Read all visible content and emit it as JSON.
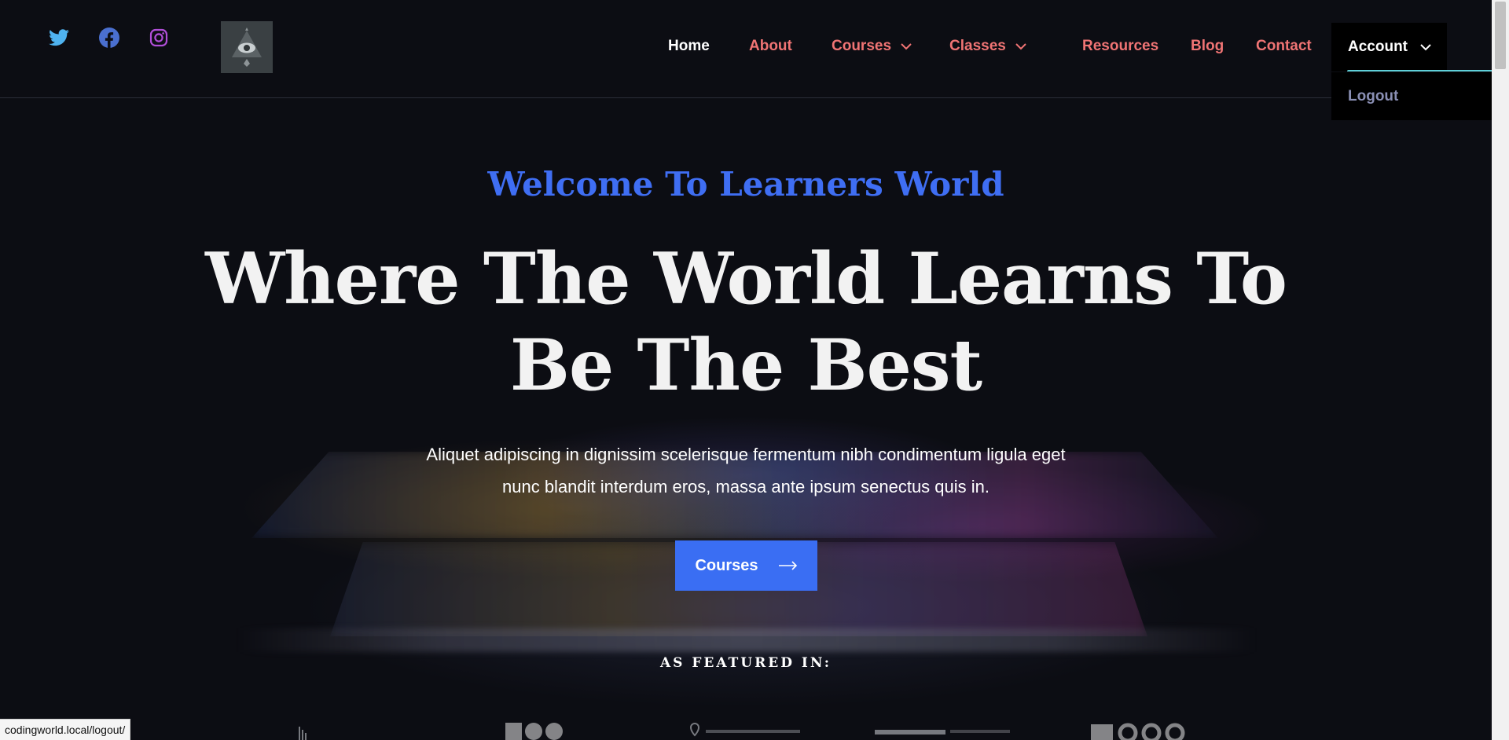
{
  "nav": {
    "home": "Home",
    "about": "About",
    "courses": "Courses",
    "classes": "Classes",
    "resources": "Resources",
    "blog": "Blog",
    "contact": "Contact",
    "account": "Account",
    "dropdown": {
      "logout": "Logout"
    }
  },
  "social": [
    "twitter-icon",
    "facebook-icon",
    "instagram-icon"
  ],
  "hero": {
    "eyebrow": "Welcome To Learners World",
    "headline_line1": "Where The World Learns To",
    "headline_line2": "Be The Best",
    "subtext_line1": "Aliquet adipiscing in dignissim scelerisque fermentum nibh condimentum ligula eget",
    "subtext_line2": "nunc blandit interdum eros, massa ante ipsum senectus quis in.",
    "cta": "Courses"
  },
  "featured": {
    "label": "AS FEATURED IN:"
  },
  "status_bar": {
    "url": "codingworld.local/logout/"
  },
  "colors": {
    "background": "#0c0d13",
    "nav_link": "#f07474",
    "accent_blue": "#3a6ef3",
    "logout": "#8a8fb4",
    "underline": "#5fd0d8"
  }
}
